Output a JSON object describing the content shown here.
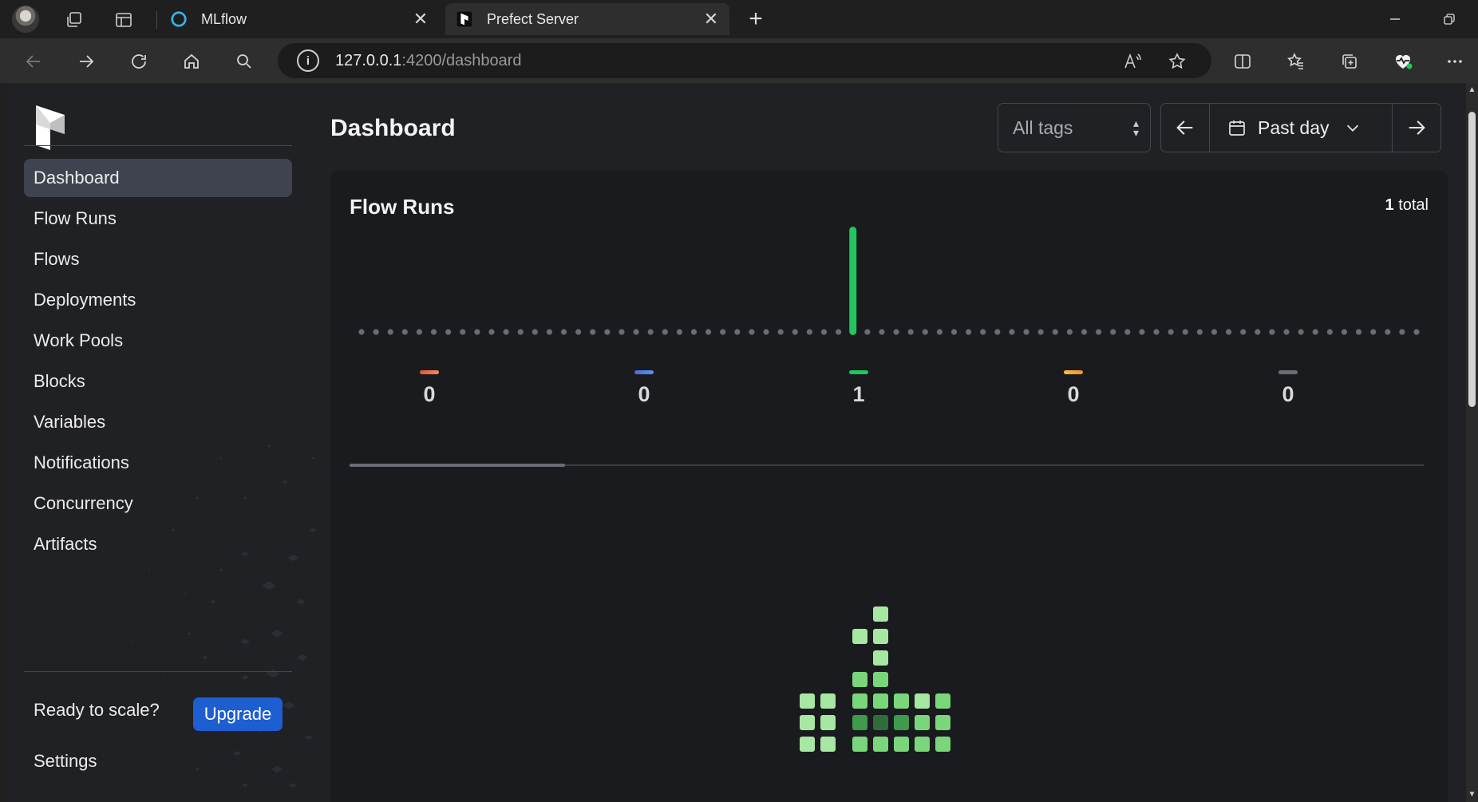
{
  "browser": {
    "tabs": [
      {
        "title": "MLflow",
        "icon": "mlflow-logo-icon",
        "active": false
      },
      {
        "title": "Prefect Server",
        "icon": "prefect-logo-icon",
        "active": true
      }
    ],
    "url_host": "127.0.0.1",
    "url_path": ":4200/dashboard"
  },
  "sidebar": {
    "items": [
      {
        "label": "Dashboard",
        "active": true
      },
      {
        "label": "Flow Runs"
      },
      {
        "label": "Flows"
      },
      {
        "label": "Deployments"
      },
      {
        "label": "Work Pools"
      },
      {
        "label": "Blocks"
      },
      {
        "label": "Variables"
      },
      {
        "label": "Notifications"
      },
      {
        "label": "Concurrency"
      },
      {
        "label": "Artifacts"
      }
    ],
    "scale_text": "Ready to scale?",
    "upgrade_label": "Upgrade",
    "settings_label": "Settings"
  },
  "header": {
    "title": "Dashboard",
    "tags_placeholder": "All tags",
    "range_label": "Past day"
  },
  "flow_runs": {
    "title": "Flow Runs",
    "total_count": "1",
    "total_suffix": "total",
    "states": [
      {
        "count": "0",
        "color": "#e5533d",
        "color2": "#f08a5d"
      },
      {
        "count": "0",
        "color": "#4a6bd8",
        "color2": "#5b8ff0"
      },
      {
        "count": "1",
        "color": "#22c55e",
        "color2": "#22c55e"
      },
      {
        "count": "0",
        "color": "#f5c242",
        "color2": "#f08a3a"
      },
      {
        "count": "0",
        "color": "#6b6d72",
        "color2": "#6b6d72"
      }
    ]
  },
  "chart_data": {
    "type": "bar",
    "bucket_count": 74,
    "values_nonzero": [
      {
        "index": 34,
        "value": 1
      }
    ],
    "bar_color": "#22c55e",
    "empty_color": "#6b6d72"
  },
  "colors": {
    "accent": "#1d5fd1",
    "active_nav": "#3f4350"
  }
}
